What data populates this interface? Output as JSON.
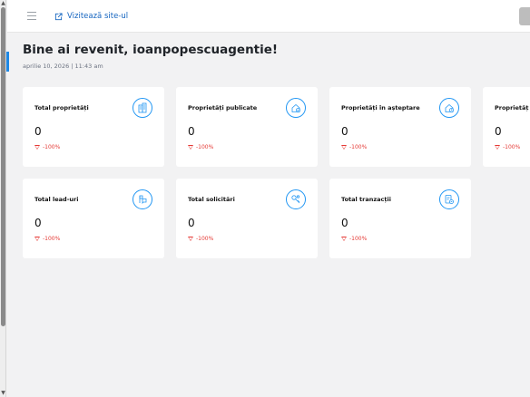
{
  "header": {
    "menu_icon": "hamburger-icon",
    "visit_site_icon": "external-link-icon",
    "visit_site_label": "Vizitează site-ul"
  },
  "main": {
    "welcome": "Bine ai revenit, ioanpopescuagentie!",
    "datestamp": "aprilie 10, 2026 | 11:43 am"
  },
  "cards": [
    {
      "title": "Total proprietăți",
      "value": "0",
      "delta": "-100%",
      "icon": "building-icon"
    },
    {
      "title": "Proprietăți publicate",
      "value": "0",
      "delta": "-100%",
      "icon": "house-check-icon"
    },
    {
      "title": "Proprietăți în așteptare",
      "value": "0",
      "delta": "-100%",
      "icon": "house-clock-icon"
    },
    {
      "title": "Proprietăț",
      "value": "0",
      "delta": "-100%",
      "icon": ""
    },
    {
      "title": "Total lead-uri",
      "value": "0",
      "delta": "-100%",
      "icon": "lead-icon"
    },
    {
      "title": "Total solicitări",
      "value": "0",
      "delta": "-100%",
      "icon": "key-icon"
    },
    {
      "title": "Total tranzacții",
      "value": "0",
      "delta": "-100%",
      "icon": "transaction-icon"
    }
  ],
  "colors": {
    "accent": "#2196f3",
    "link": "#1565c0",
    "negative": "#e53935",
    "background": "#f2f2f3"
  }
}
